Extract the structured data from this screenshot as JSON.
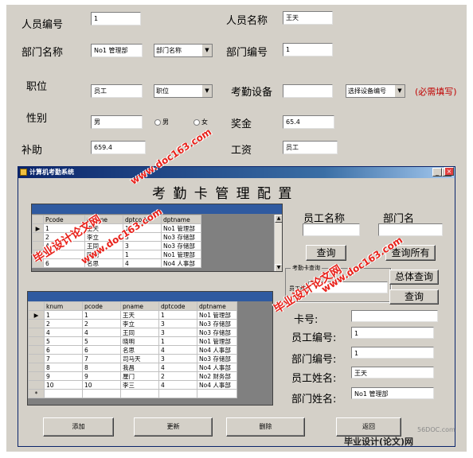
{
  "top_form": {
    "person_no_label": "人员编号",
    "person_no_value": "1",
    "person_name_label": "人员名称",
    "person_name_value": "王天",
    "dept_name_label": "部门名称",
    "dept_name_value": "No1 管理部",
    "dept_combo_value": "部门名称",
    "dept_no_label": "部门编号",
    "dept_no_value": "1",
    "position_label": "职位",
    "position_value": "员工",
    "position_combo_value": "职位",
    "device_label": "考勤设备",
    "device_value": "",
    "device_combo_value": "选择设备编号",
    "required_note": "(必需填写)",
    "gender_label": "性别",
    "gender_value": "男",
    "gender_male": "男",
    "gender_female": "女",
    "bonus_label": "奖金",
    "bonus_value": "65.4",
    "subsidy_label": "补助",
    "subsidy_value": "659.4",
    "salary_label": "工资",
    "salary_value": "员工"
  },
  "window": {
    "title": "计算机考勤系统",
    "heading": "考 勤 卡 管 理 配 置",
    "upper_grid": {
      "headers": [
        "Pcode",
        "pname",
        "dptcode",
        "dptname"
      ],
      "rows": [
        [
          "1",
          "王天",
          "1",
          "No1 管理部"
        ],
        [
          "2",
          "李立",
          "3",
          "No3 存储部"
        ],
        [
          "4",
          "王同",
          "3",
          "No3 存储部"
        ],
        [
          "5",
          "晓明",
          "1",
          "No1 管理部"
        ],
        [
          "6",
          "名思",
          "4",
          "No4 人事部"
        ]
      ]
    },
    "lower_grid": {
      "headers": [
        "knum",
        "pcode",
        "pname",
        "dptcode",
        "dptname"
      ],
      "rows": [
        [
          "1",
          "1",
          "王天",
          "1",
          "No1 管理部"
        ],
        [
          "2",
          "2",
          "李立",
          "3",
          "No3 存储部"
        ],
        [
          "4",
          "4",
          "王同",
          "3",
          "No3 存储部"
        ],
        [
          "5",
          "5",
          "晓明",
          "1",
          "No1 管理部"
        ],
        [
          "6",
          "6",
          "名思",
          "4",
          "No4 人事部"
        ],
        [
          "7",
          "7",
          "司马天",
          "3",
          "No3 存储部"
        ],
        [
          "8",
          "8",
          "我昌",
          "4",
          "No4 人事部"
        ],
        [
          "9",
          "9",
          "厘门",
          "2",
          "No2 财务部"
        ],
        [
          "10",
          "10",
          "李三",
          "4",
          "No4 人事部"
        ]
      ],
      "new_row_marker": "*"
    },
    "emp_name_label": "员工名称",
    "dept_name2_label": "部门名",
    "query_button": "查询",
    "query_all_button": "查询所有",
    "card_query_group": "考勤卡查询",
    "emp_no_small_label": "员工编",
    "total_query_button": "总体查询",
    "query2_button": "查询",
    "card_no_label": "卡号:",
    "card_no_value": "",
    "emp_no_label": "员工编号:",
    "emp_no_value": "1",
    "dept_no_label": "部门编号:",
    "dept_no_value": "1",
    "emp_name2_label": "员工姓名:",
    "emp_name2_value": "王天",
    "dept_name3_label": "部门姓名:",
    "dept_name3_value": "No1 管理部",
    "add_button": "添加",
    "update_button": "更新",
    "delete_button": "删除",
    "back_button": "返回"
  },
  "watermarks": {
    "site_a": "www.doc163.com",
    "brand_a": "毕业设计论文网",
    "site_b": "www.doc163.com",
    "brand_b": "毕业设计论文网",
    "site_c": "www.doc163.com"
  },
  "footer": {
    "logo_text": "毕业设计(论文)网",
    "logo_site": "56DOC.com"
  },
  "colors": {
    "form_bg": "#d4d0c8",
    "titlebar": "#0a246a",
    "watermark": "#e8221b",
    "required_note": "#c00000"
  }
}
